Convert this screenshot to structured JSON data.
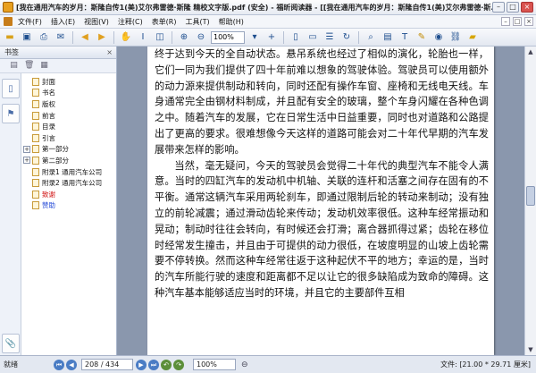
{
  "window": {
    "title": "[我在通用汽车的岁月：斯隆自传1(美)艾尔弗雷德·斯隆 精校文字版.pdf (安全) - 福昕阅读器 - [[我在通用汽车的岁月：斯隆自传1(美)艾尔弗雷德·斯..."
  },
  "menu": {
    "items": [
      "文件(F)",
      "插入(E)",
      "视图(V)",
      "注释(C)",
      "表单(R)",
      "工具(T)",
      "帮助(H)"
    ]
  },
  "toolbar": {
    "zoom_value": "100%"
  },
  "sidebar": {
    "header": "书签",
    "close_glyph": "×",
    "items": [
      {
        "label": "封面",
        "expandable": false,
        "color": "normal"
      },
      {
        "label": "书名",
        "expandable": false,
        "color": "normal"
      },
      {
        "label": "版权",
        "expandable": false,
        "color": "normal"
      },
      {
        "label": "前言",
        "expandable": false,
        "color": "normal"
      },
      {
        "label": "目录",
        "expandable": false,
        "color": "normal"
      },
      {
        "label": "引言",
        "expandable": false,
        "color": "normal"
      },
      {
        "label": "第一部分",
        "expandable": true,
        "color": "normal"
      },
      {
        "label": "第二部分",
        "expandable": true,
        "color": "normal"
      },
      {
        "label": "附录1 通用汽车公司",
        "expandable": false,
        "color": "normal"
      },
      {
        "label": "附录2 通用汽车公司",
        "expandable": false,
        "color": "normal"
      },
      {
        "label": "致谢",
        "expandable": false,
        "color": "red"
      },
      {
        "label": "赞助",
        "expandable": false,
        "color": "blue"
      }
    ]
  },
  "document": {
    "paragraphs": [
      {
        "indent": false,
        "text": "终于达到今天的全自动状态。悬吊系统也经过了相似的演化，轮胎也一样，它们一同为我们提供了四十年前难以想象的驾驶体验。驾驶员可以使用额外的动力源来提供制动和转向，同时还配有操作车窗、座椅和无线电天线。车身通常完全由钢材料制成，并且配有安全的玻璃，整个车身闪耀在各种色调之中。随着汽车的发展，它在日常生活中日益重要，同时也对道路和公路提出了更高的要求。很难想像今天这样的道路可能会对二十年代早期的汽车发展带来怎样的影响。"
      },
      {
        "indent": true,
        "text": "当然，毫无疑问，今天的驾驶员会觉得二十年代的典型汽车不能令人满意。当时的四缸汽车的发动机中机轴、关联的连杆和活塞之间存在固有的不平衡。通常这辆汽车采用两轮刹车，即通过限制后轮的转动来制动；没有独立的前轮减震；通过滑动齿轮来传动；发动机效率很低。这种车经常振动和晃动；制动时往往会转向，有时候还会打滑；离合器抓得过紧；齿轮在移位时经常发生撞击，并且由于可提供的动力很低，在坡度明显的山坡上齿轮需要不停转换。然而这种车经常往返于这种起伏不平的地方；幸运的是，当时的汽车所能行驶的速度和距离都不足以让它的很多缺陷成为致命的障碍。这种汽车基本能够适应当时的环境，并且它的主要部件互相"
      }
    ]
  },
  "status": {
    "ready": "就绪",
    "page_indicator": "208 / 434",
    "zoom": "100%",
    "page_size": "文件: [21.00 * 29.71 厘米]"
  },
  "scroll": {
    "position_fraction": 0.48
  }
}
